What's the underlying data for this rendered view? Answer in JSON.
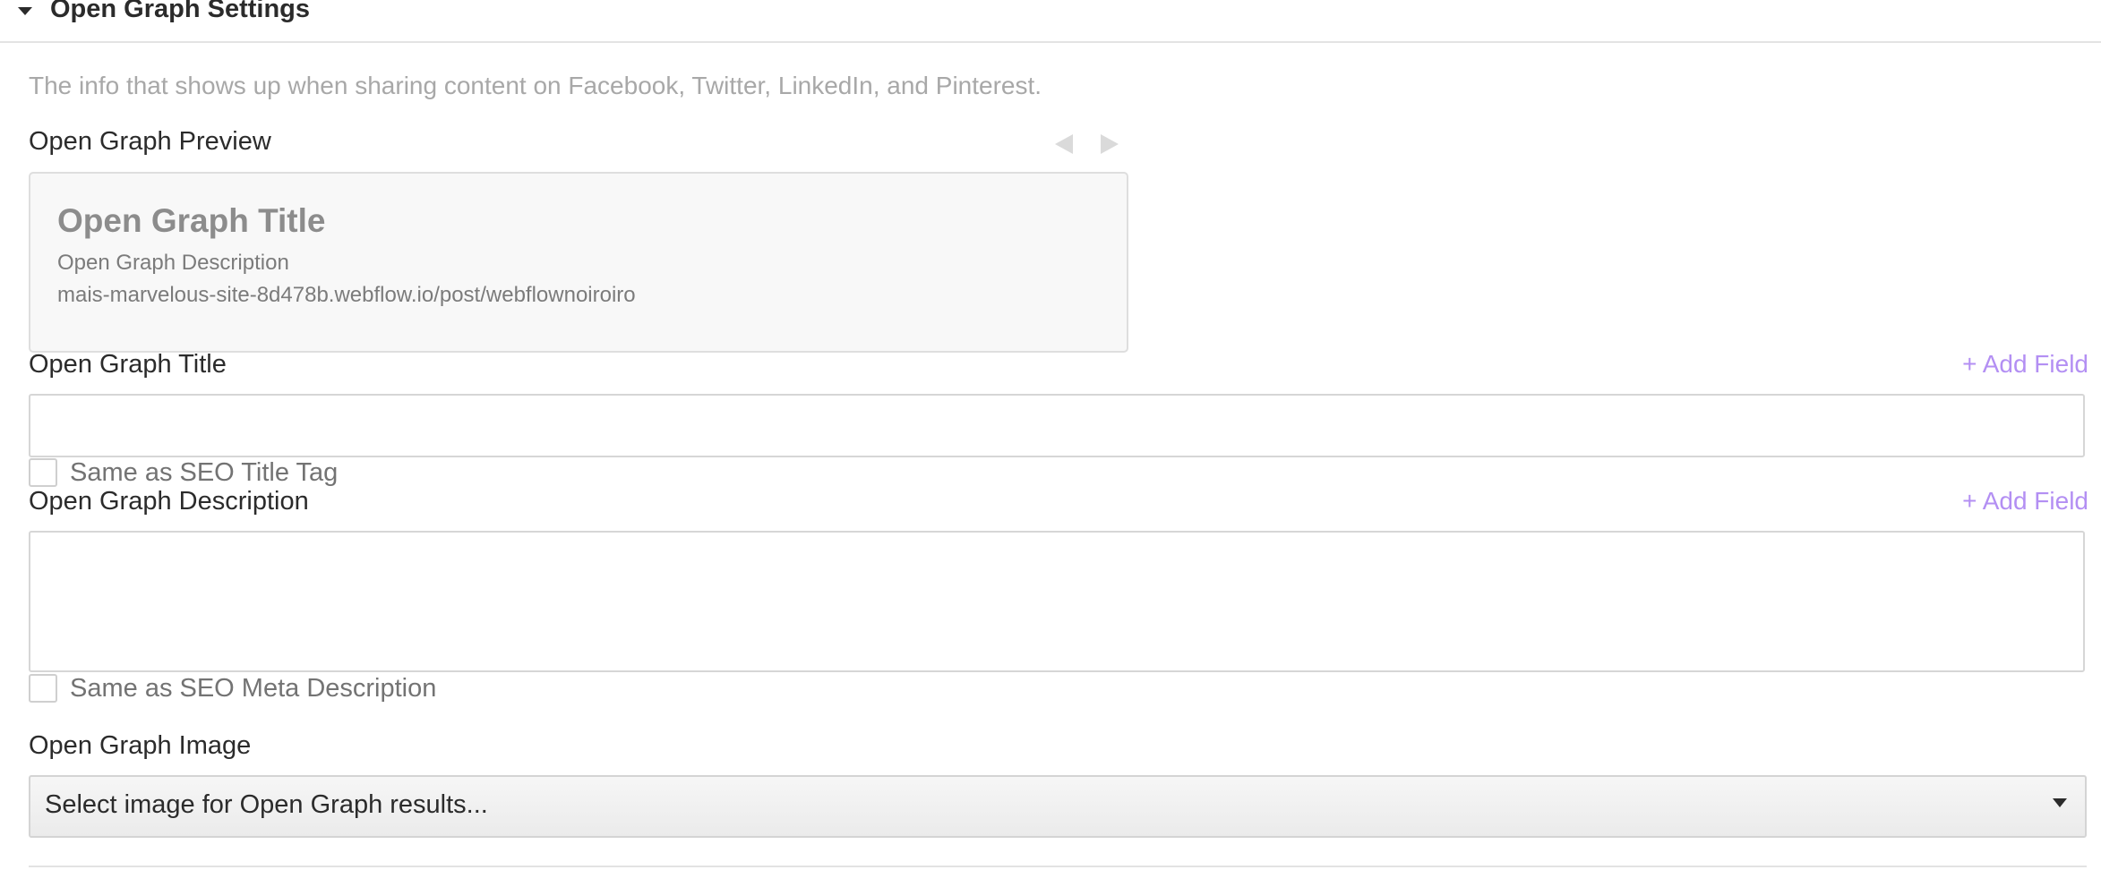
{
  "section": {
    "title": "Open Graph Settings",
    "intro": "The info that shows up when sharing content on Facebook, Twitter, LinkedIn, and Pinterest."
  },
  "preview": {
    "label": "Open Graph Preview",
    "title": "Open Graph Title",
    "description": "Open Graph Description",
    "url": "mais-marvelous-site-8d478b.webflow.io/post/webflownoiroiro"
  },
  "og_title": {
    "label": "Open Graph Title",
    "add_field": "+ Add Field",
    "value": "",
    "checkbox_label": "Same as SEO Title Tag",
    "checked": false
  },
  "og_description": {
    "label": "Open Graph Description",
    "add_field": "+ Add Field",
    "value": "",
    "checkbox_label": "Same as SEO Meta Description",
    "checked": false
  },
  "og_image": {
    "label": "Open Graph Image",
    "select_value": "Select image for Open Graph results..."
  },
  "colors": {
    "accent": "#b38ff3",
    "muted_text": "#a8a8a8",
    "border": "#d6d6d6"
  },
  "icons": {
    "section_toggle": "caret-down-icon",
    "preview_prev": "arrow-left-icon",
    "preview_next": "arrow-right-icon",
    "select_toggle": "caret-down-icon"
  }
}
